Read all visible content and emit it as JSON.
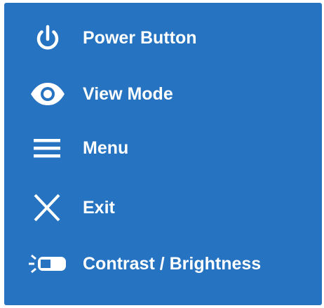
{
  "legend": {
    "items": [
      {
        "icon": "power-icon",
        "label": "Power Button"
      },
      {
        "icon": "eye-icon",
        "label": "View Mode"
      },
      {
        "icon": "menu-icon",
        "label": "Menu"
      },
      {
        "icon": "close-icon",
        "label": "Exit"
      },
      {
        "icon": "contrast-brightness-icon",
        "label": "Contrast / Brightness"
      }
    ]
  },
  "colors": {
    "panel_background": "#2673c1",
    "foreground": "#ffffff"
  }
}
